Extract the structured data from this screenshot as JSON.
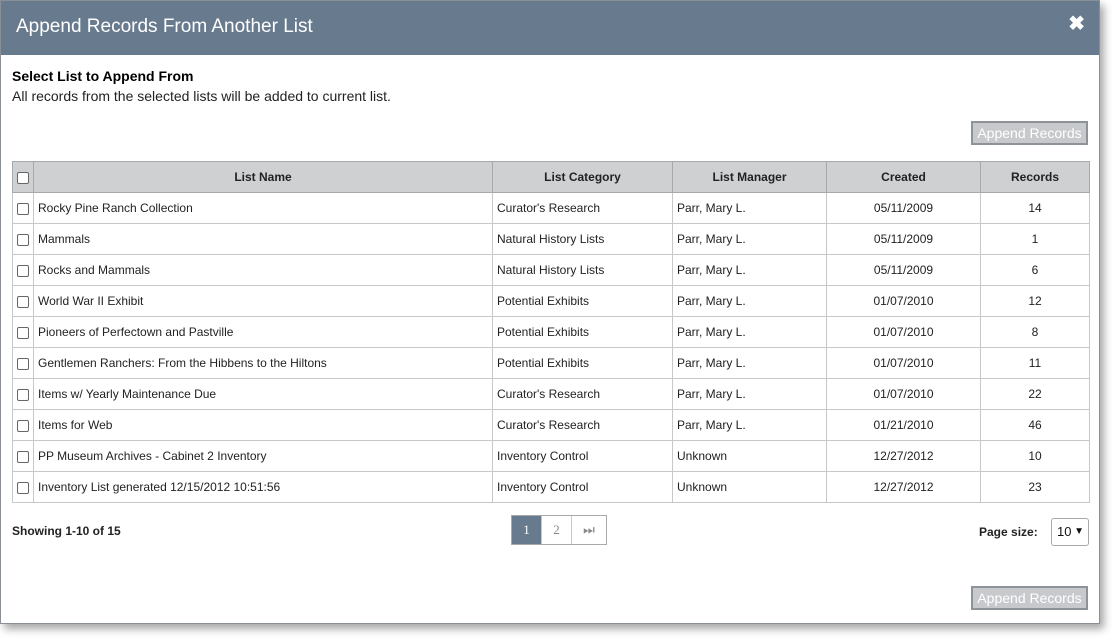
{
  "dialog": {
    "title": "Append Records From Another List",
    "close_glyph": "✖",
    "heading": "Select List to Append From",
    "subtext": "All records from the selected lists will be added to current list.",
    "append_label": "Append Records"
  },
  "table": {
    "headers": [
      "List Name",
      "List Category",
      "List Manager",
      "Created",
      "Records"
    ],
    "rows": [
      [
        "Rocky Pine Ranch Collection",
        "Curator's Research",
        "Parr, Mary L.",
        "05/11/2009",
        "14"
      ],
      [
        "Mammals",
        "Natural History Lists",
        "Parr, Mary L.",
        "05/11/2009",
        "1"
      ],
      [
        "Rocks and Mammals",
        "Natural History Lists",
        "Parr, Mary L.",
        "05/11/2009",
        "6"
      ],
      [
        "World War II Exhibit",
        "Potential Exhibits",
        "Parr, Mary L.",
        "01/07/2010",
        "12"
      ],
      [
        "Pioneers of Perfectown and Pastville",
        "Potential Exhibits",
        "Parr, Mary L.",
        "01/07/2010",
        "8"
      ],
      [
        "Gentlemen Ranchers: From the Hibbens to the Hiltons",
        "Potential Exhibits",
        "Parr, Mary L.",
        "01/07/2010",
        "11"
      ],
      [
        "Items w/ Yearly Maintenance Due",
        "Curator's Research",
        "Parr, Mary L.",
        "01/07/2010",
        "22"
      ],
      [
        "Items for Web",
        "Curator's Research",
        "Parr, Mary L.",
        "01/21/2010",
        "46"
      ],
      [
        "PP Museum Archives - Cabinet 2 Inventory",
        "Inventory Control",
        "Unknown",
        "12/27/2012",
        "10"
      ],
      [
        "Inventory List generated 12/15/2012 10:51:56",
        "Inventory Control",
        "Unknown",
        "12/27/2012",
        "23"
      ]
    ]
  },
  "footer": {
    "showing": "Showing 1-10 of 15",
    "pages": [
      "1",
      "2"
    ],
    "last_page_glyph": "⏭",
    "page_size_label": "Page size:",
    "page_size_value": "10"
  },
  "icons": {
    "close": "close-icon",
    "last_page": "last-page-icon",
    "dropdown": "chevron-down-icon"
  },
  "colors": {
    "titlebar": "#677a8e",
    "header_bg": "#cfd0d2",
    "button_bg": "#c7c9cc"
  }
}
